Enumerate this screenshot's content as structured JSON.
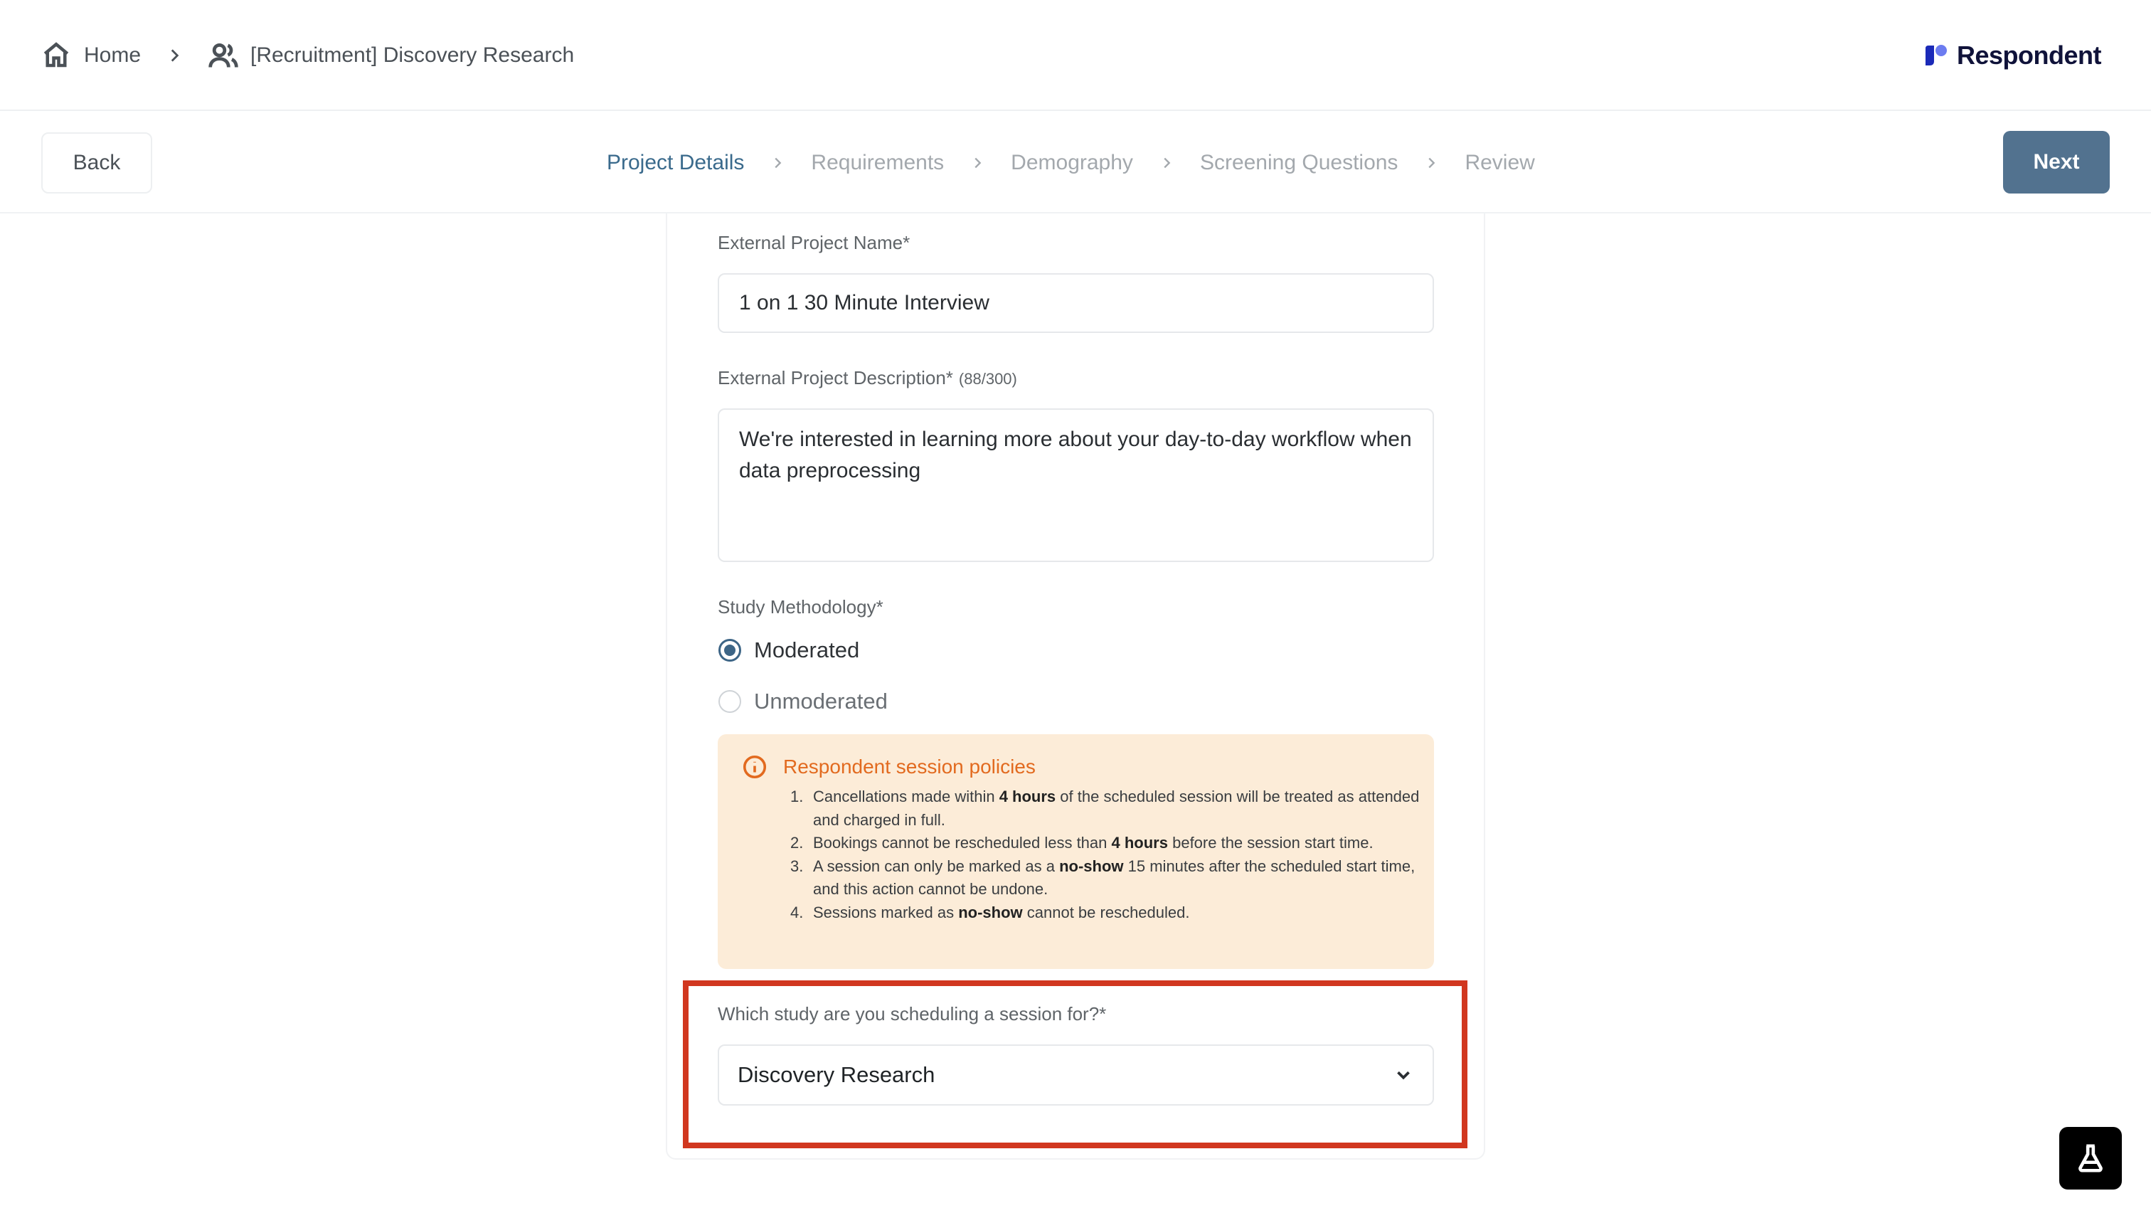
{
  "header": {
    "home_label": "Home",
    "project_label": "[Recruitment] Discovery Research",
    "brand_name": "Respondent"
  },
  "stepper": {
    "back_label": "Back",
    "next_label": "Next",
    "steps": [
      {
        "label": "Project Details",
        "active": true
      },
      {
        "label": "Requirements",
        "active": false
      },
      {
        "label": "Demography",
        "active": false
      },
      {
        "label": "Screening Questions",
        "active": false
      },
      {
        "label": "Review",
        "active": false
      }
    ]
  },
  "form": {
    "external_name_label": "External Project Name*",
    "external_name_value": "1 on 1 30 Minute Interview",
    "description_label": "External Project Description*",
    "description_counter": "(88/300)",
    "description_value": "We're interested in learning more about your day-to-day workflow when data preprocessing",
    "methodology_label": "Study Methodology*",
    "methodology_options": [
      {
        "label": "Moderated",
        "checked": true
      },
      {
        "label": "Unmoderated",
        "checked": false
      }
    ],
    "policy": {
      "title": "Respondent session policies",
      "items": [
        {
          "num": "1.",
          "pre": "Cancellations made within ",
          "bold": "4 hours",
          "post": " of the scheduled session will be treated as attended and charged in full."
        },
        {
          "num": "2.",
          "pre": "Bookings cannot be rescheduled less than ",
          "bold": "4 hours",
          "post": " before the session start time."
        },
        {
          "num": "3.",
          "pre": "A session can only be marked as a ",
          "bold": "no-show",
          "post": " 15 minutes after the scheduled start time, and this action cannot be undone."
        },
        {
          "num": "4.",
          "pre": "Sessions marked as ",
          "bold": "no-show",
          "post": " cannot be rescheduled."
        }
      ]
    },
    "study_select_label": "Which study are you scheduling a session for?*",
    "study_select_value": "Discovery Research"
  },
  "colors": {
    "primary": "#52728f",
    "active_step": "#3a6a8c",
    "policy_bg": "#fcecd8",
    "policy_accent": "#e26a1f",
    "highlight": "#d1371f",
    "brand": "#10133a"
  },
  "icons": {
    "home": "home-icon",
    "project": "users-icon",
    "chevron": "chevron-right-icon",
    "info": "info-icon",
    "dropdown": "chevron-down-icon",
    "fab": "flask-icon"
  }
}
